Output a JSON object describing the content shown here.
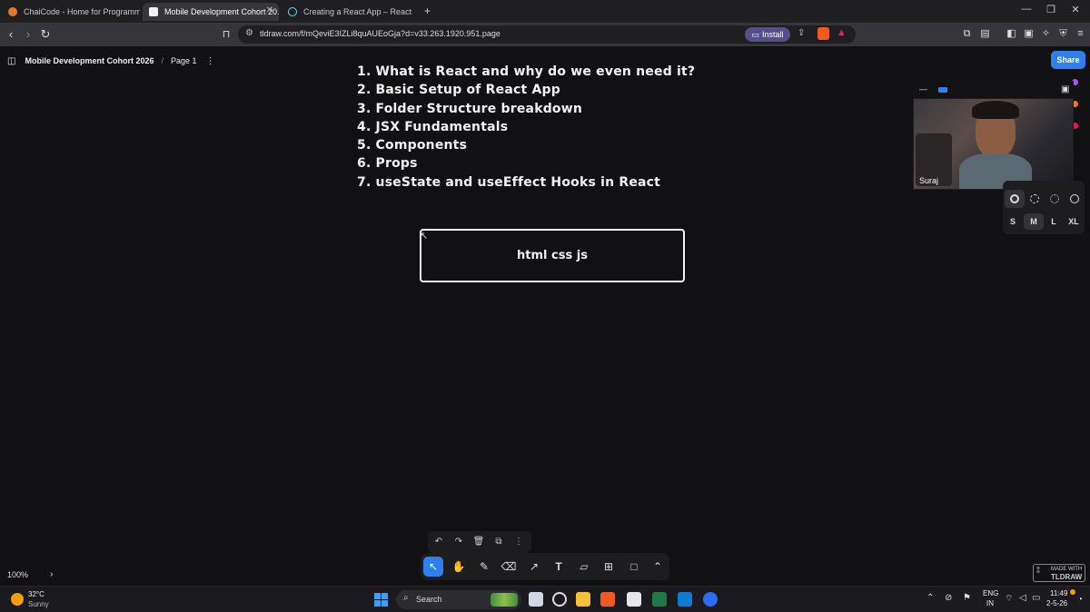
{
  "browser": {
    "tabs": [
      {
        "label": "ChaiCode - Home for Programmers",
        "active": false
      },
      {
        "label": "Mobile Development Cohort 20…",
        "active": true
      },
      {
        "label": "Creating a React App – React",
        "active": false
      }
    ],
    "new_tab_glyph": "+",
    "url": "tldraw.com/f/mQeviE3IZLi8quAUEoGja?d=v33.263.1920.951.page",
    "install_label": "Install"
  },
  "app": {
    "file_title": "Mobile Development Cohort 2026",
    "breadcrumb_sep": "/",
    "page_name": "Page 1",
    "share_label": "Share",
    "zoom": "100%",
    "made_with_top": "MADE WITH",
    "made_with_bottom": "TLDRAW"
  },
  "canvas": {
    "agenda": [
      "1. What is React and why do we even need it?",
      "2. Basic Setup of React App",
      "3. Folder Structure breakdown",
      "4. JSX Fundamentals",
      "5. Components",
      "6. Props",
      "7. useState and useEffect Hooks in React"
    ],
    "box_text": "html css js"
  },
  "style_panel": {
    "sizes": [
      "S",
      "M",
      "L",
      "XL"
    ],
    "selected_size": "M"
  },
  "webcam": {
    "name": "Suraj"
  },
  "taskbar": {
    "temperature": "32°C",
    "weather": "Sunny",
    "search_label": "Search",
    "lang_top": "ENG",
    "lang_bottom": "IN",
    "time": "11:49",
    "date": "2-5-26"
  },
  "colors": {
    "accent": "#2f80ed",
    "canvas_bg": "#111113",
    "install_bg": "#55508a"
  }
}
